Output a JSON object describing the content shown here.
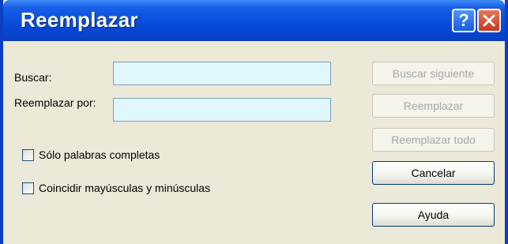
{
  "window": {
    "title": "Reemplazar",
    "help_glyph": "?"
  },
  "form": {
    "find_label": "Buscar:",
    "find_value": "",
    "replace_label": "Reemplazar por:",
    "replace_value": "",
    "whole_words_label": "Sólo palabras completas",
    "whole_words_checked": false,
    "match_case_label": "Coincidir mayúsculas y minúsculas",
    "match_case_checked": false
  },
  "buttons": {
    "find_next": "Buscar siguiente",
    "replace": "Reemplazar",
    "replace_all": "Reemplazar todo",
    "cancel": "Cancelar",
    "help": "Ayuda"
  },
  "colors": {
    "titlebar": "#0a52e0",
    "field_bg": "#dff7fb",
    "dialog_bg": "#ece9d8",
    "close_button": "#c6391f"
  },
  "icons": {
    "help": "help-icon",
    "close": "close-icon"
  }
}
